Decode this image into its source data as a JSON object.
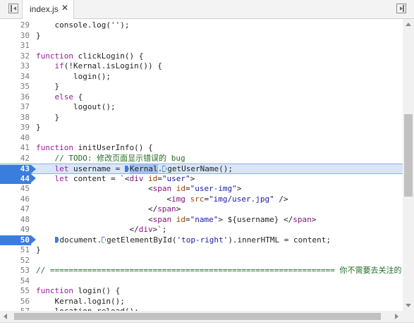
{
  "tab": {
    "label": "index.js",
    "close_glyph": "✕"
  },
  "toolbar": {
    "left_icon": "toggle-navigator-icon",
    "right_icon": "toggle-debugger-icon"
  },
  "lines": [
    {
      "n": "29",
      "code": "    console.log('');"
    },
    {
      "n": "30",
      "code": "}"
    },
    {
      "n": "31",
      "code": ""
    },
    {
      "n": "32",
      "code": "function clickLogin() {"
    },
    {
      "n": "33",
      "code": "    if(!Kernal.isLogin()) {"
    },
    {
      "n": "34",
      "code": "        login();"
    },
    {
      "n": "35",
      "code": "    }"
    },
    {
      "n": "36",
      "code": "    else {"
    },
    {
      "n": "37",
      "code": "        logout();"
    },
    {
      "n": "38",
      "code": "    }"
    },
    {
      "n": "39",
      "code": "}"
    },
    {
      "n": "40",
      "code": ""
    },
    {
      "n": "41",
      "code": "function initUserInfo() {"
    },
    {
      "n": "42",
      "code": "    // TODO: 修改页面显示错误的 bug"
    },
    {
      "n": "43",
      "code": "    let username = Kernal.getUserName();"
    },
    {
      "n": "44",
      "code": "    let content = `<div id=\"user\">"
    },
    {
      "n": "45",
      "code": "                        <span id=\"user-img\">"
    },
    {
      "n": "46",
      "code": "                            <img src=\"img/user.jpg\" />"
    },
    {
      "n": "47",
      "code": "                        </span>"
    },
    {
      "n": "48",
      "code": "                        <span id=\"name\"> ${username} </span>"
    },
    {
      "n": "49",
      "code": "                    </div>`;"
    },
    {
      "n": "50",
      "code": "    document.getElementById('top-right').innerHTML = content;"
    },
    {
      "n": "51",
      "code": "}"
    },
    {
      "n": "52",
      "code": ""
    },
    {
      "n": "53",
      "code": "// ============================================================= 你不需要去关注的"
    },
    {
      "n": "54",
      "code": ""
    },
    {
      "n": "55",
      "code": "function login() {"
    },
    {
      "n": "56",
      "code": "    Kernal.login();"
    },
    {
      "n": "57",
      "code": "    location.reload();"
    }
  ],
  "breakpoints": [
    "43",
    "44",
    "50"
  ],
  "selected_line": "43",
  "colors": {
    "keyword": "#9a1b9a",
    "string": "#1a1aa6",
    "comment": "#236e25",
    "breakpoint": "#3b7ddd",
    "selection": "#d9e6f7"
  }
}
